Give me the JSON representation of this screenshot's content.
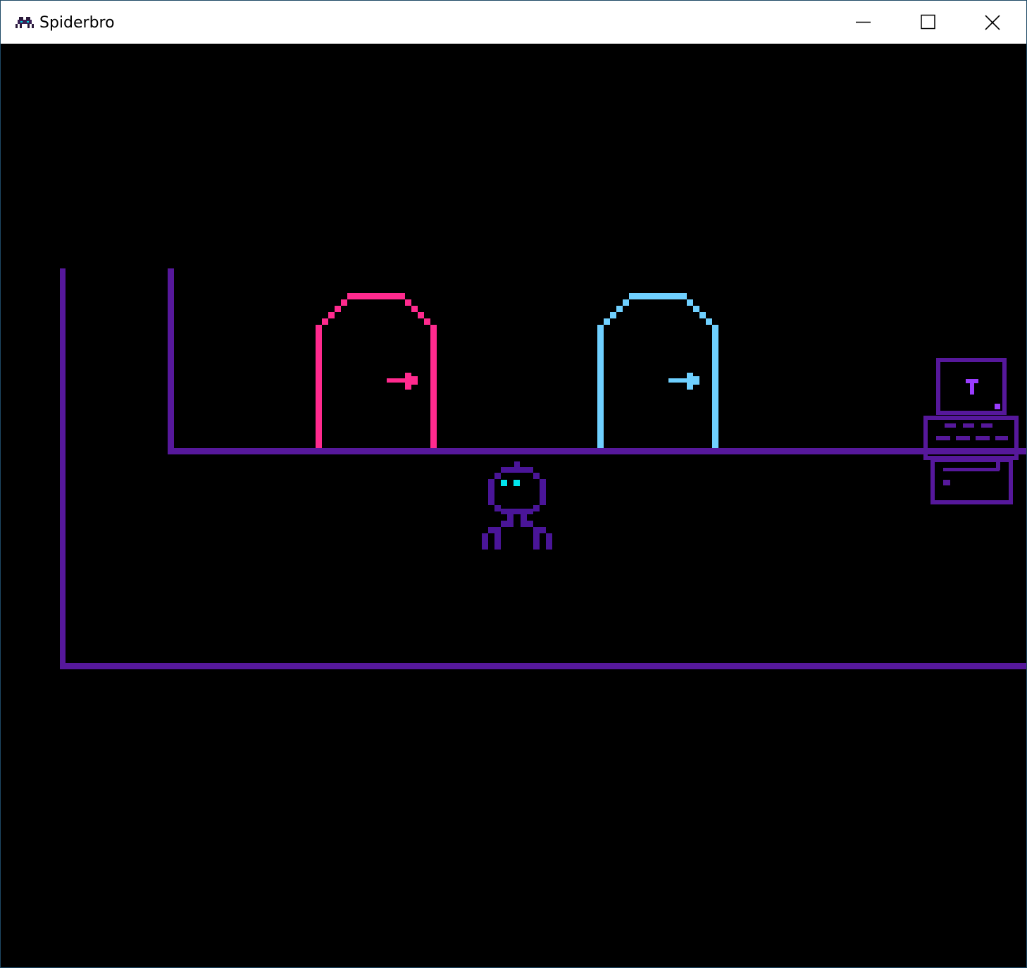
{
  "window": {
    "title": "Spiderbro",
    "app_icon": "spider-icon",
    "controls": {
      "minimize": "minimize-icon",
      "maximize": "maximize-icon",
      "close": "close-icon"
    }
  },
  "game": {
    "colors": {
      "background": "#000000",
      "wall": "#56189b",
      "door_pink": "#ff2a8e",
      "door_blue": "#6fd0ff",
      "player_body": "#4a1598",
      "player_eyes": "#00e5ee",
      "terminal": "#56189b",
      "terminal_glyph": "#9a3cff"
    },
    "terminal_glyph": "T",
    "doors": [
      {
        "color": "pink",
        "icon": "arrow-right-icon"
      },
      {
        "color": "blue",
        "icon": "arrow-right-icon"
      }
    ]
  }
}
